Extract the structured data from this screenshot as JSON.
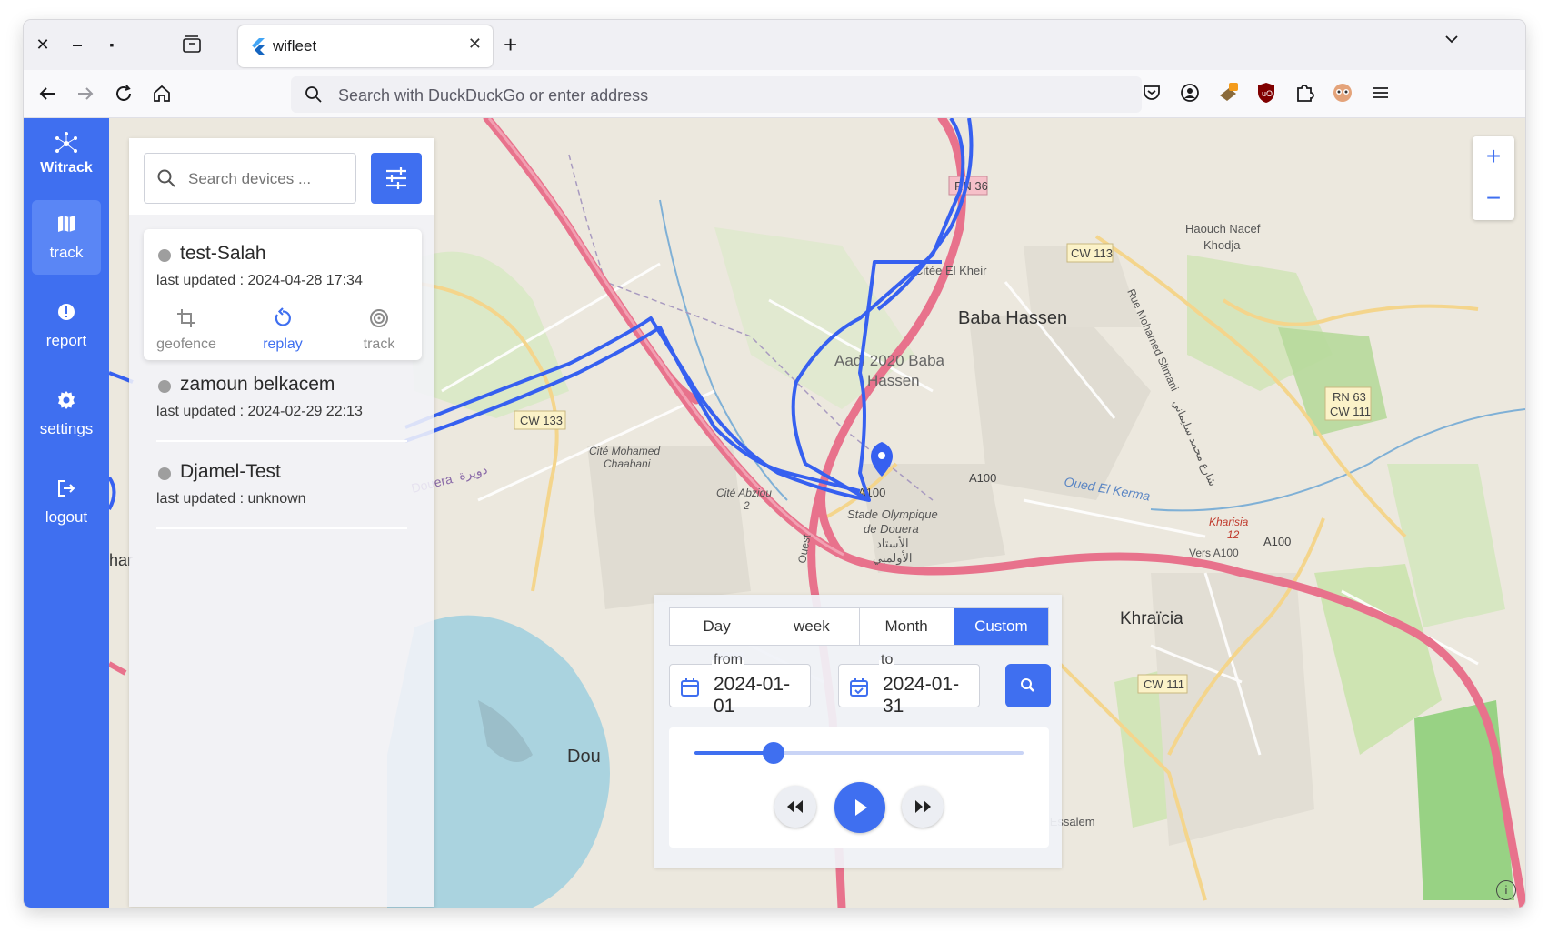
{
  "browser": {
    "tab_title": "wifleet",
    "address_placeholder": "Search with DuckDuckGo or enter address"
  },
  "app": {
    "logo": "Witrack",
    "sidebar": [
      {
        "label": "track",
        "icon": "map-icon",
        "active": true
      },
      {
        "label": "report",
        "icon": "alert-icon",
        "active": false
      },
      {
        "label": "settings",
        "icon": "gear-icon",
        "active": false
      },
      {
        "label": "logout",
        "icon": "logout-icon",
        "active": false
      }
    ],
    "search_placeholder": "Search devices ...",
    "devices": [
      {
        "name": "test-Salah",
        "updated": "last updated : 2024-04-28 17:34"
      },
      {
        "name": "zamoun belkacem",
        "updated": "last updated : 2024-02-29 22:13"
      },
      {
        "name": "Djamel-Test",
        "updated": "last updated : unknown"
      }
    ],
    "device_actions": [
      "geofence",
      "replay",
      "track"
    ],
    "active_action": "replay"
  },
  "replay": {
    "periods": [
      "Day",
      "week",
      "Month",
      "Custom"
    ],
    "active_period": "Custom",
    "from_label": "from",
    "from_value": "2024-01-01",
    "to_label": "to",
    "to_value": "2024-01-31",
    "progress": 0.24
  },
  "map": {
    "labels": {
      "baba_hassen": "Baba Hassen",
      "aadl1": "Aadl 2020 Baba",
      "aadl2": "Hassen",
      "citee": "Citée El Kheir",
      "haouch1": "Haouch Nacef",
      "haouch2": "Khodja",
      "khraicia": "Khraïcia",
      "kharisia": "Kharisia",
      "kharisia_num": "12",
      "cite_chaabani1": "Cité Mohamed",
      "cite_chaabani2": "Chaabani",
      "cite_abziou1": "Cité Abziou",
      "cite_abziou2": "2",
      "stade1": "Stade Olympique",
      "stade2": "de Douera",
      "stade_ar1": "الأستاد",
      "stade_ar2": "الأولمبي",
      "douera": "Douera",
      "douera_ar": "دويرة",
      "oued": "Oued El Kerma",
      "hay": "Hay Essalem",
      "rue": "Rue Mohamed Slimani",
      "vers": "Vers A100",
      "dou": "Dou",
      "ouest": "Ouest",
      "ar_street": "شارع محمد سليماني"
    },
    "roads": [
      "A100",
      "RN 36",
      "CW 113",
      "CW 133",
      "RN 63",
      "CW 111"
    ],
    "colors": {
      "route": "#3660f0",
      "motorway": "#e8728c",
      "primary": "#f7cf85"
    }
  },
  "colors": {
    "accent": "#3f6ff0"
  }
}
